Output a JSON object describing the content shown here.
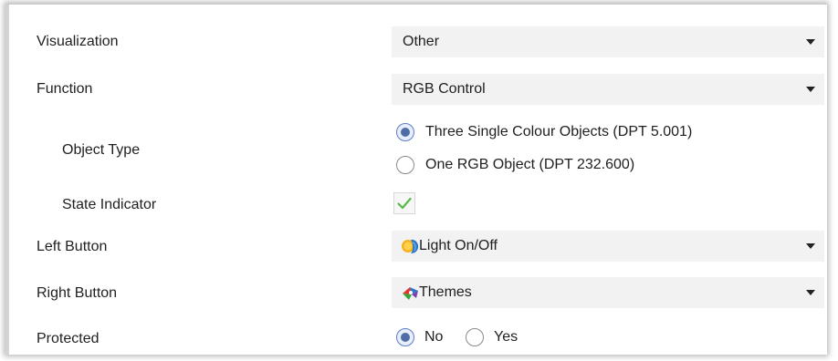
{
  "rows": {
    "visualization": {
      "label": "Visualization",
      "value": "Other"
    },
    "function": {
      "label": "Function",
      "value": "RGB Control"
    },
    "object_type": {
      "label": "Object Type",
      "options": [
        {
          "label": "Three Single Colour Objects (DPT 5.001)",
          "selected": true
        },
        {
          "label": "One RGB Object (DPT 232.600)",
          "selected": false
        }
      ]
    },
    "state_indicator": {
      "label": "State Indicator",
      "checked": true
    },
    "left_button": {
      "label": "Left Button",
      "value": "Light On/Off",
      "icon": "light-bulb-sun-icon"
    },
    "right_button": {
      "label": "Right Button",
      "value": "Themes",
      "icon": "themes-palette-icon"
    },
    "protected": {
      "label": "Protected",
      "options": [
        {
          "label": "No",
          "selected": true
        },
        {
          "label": "Yes",
          "selected": false
        }
      ]
    }
  },
  "colors": {
    "dropdown_bg": "#f2f2f2",
    "radio_accent": "#4f6ea8",
    "check_green": "#58b94a"
  }
}
